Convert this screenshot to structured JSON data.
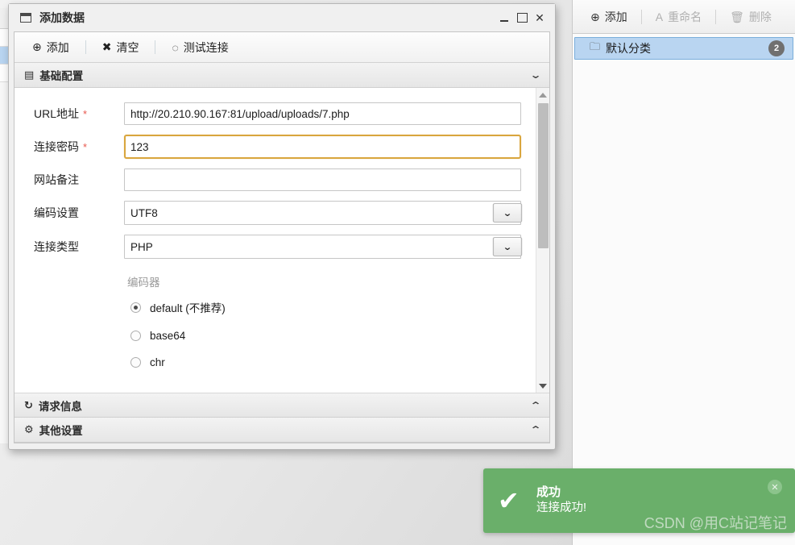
{
  "background_window": {
    "name": "partial-background-window"
  },
  "dialog": {
    "title": "添加数据",
    "title_icon": "window-icon",
    "window_controls": {
      "minimize": "－",
      "maximize": "□",
      "close": "✕"
    },
    "toolbar": [
      {
        "icon": "plus-circle-icon",
        "glyph": "⊕",
        "label": "添加"
      },
      {
        "icon": "cross-icon",
        "glyph": "✖",
        "label": "清空"
      },
      {
        "icon": "spinner-icon",
        "glyph": "◌",
        "label": "测试连接"
      }
    ],
    "sections": {
      "basic": {
        "icon": "document-icon",
        "glyph": "▤",
        "title": "基础配置",
        "chevron": "⌄",
        "expanded": true
      },
      "request": {
        "icon": "refresh-icon",
        "glyph": "↻",
        "title": "请求信息",
        "chevron": "⌃",
        "expanded": false
      },
      "other": {
        "icon": "gears-icon",
        "glyph": "⚙",
        "title": "其他设置",
        "chevron": "⌃",
        "expanded": false
      }
    },
    "form": {
      "fields": [
        {
          "label": "URL地址",
          "required": true,
          "required_mark": "*",
          "type": "text",
          "value": "http://20.210.90.167:81/upload/uploads/7.php",
          "placeholder": "",
          "focused": false
        },
        {
          "label": "连接密码",
          "required": true,
          "required_mark": "*",
          "type": "text",
          "value": "123",
          "placeholder": "",
          "focused": true
        },
        {
          "label": "网站备注",
          "required": false,
          "required_mark": "",
          "type": "text",
          "value": "",
          "placeholder": "",
          "focused": false
        },
        {
          "label": "编码设置",
          "required": false,
          "required_mark": "",
          "type": "select",
          "value": "UTF8",
          "placeholder": "",
          "focused": false
        },
        {
          "label": "连接类型",
          "required": false,
          "required_mark": "",
          "type": "select",
          "value": "PHP",
          "placeholder": "",
          "focused": false
        }
      ],
      "encoder_group": {
        "title": "编码器",
        "options": [
          {
            "label": "default (不推荐)",
            "checked": true
          },
          {
            "label": "base64",
            "checked": false
          },
          {
            "label": "chr",
            "checked": false
          }
        ]
      }
    },
    "scrollbar": {
      "up_arrow": "▲",
      "down_arrow": "▼"
    }
  },
  "right_panel": {
    "toolbar": [
      {
        "icon": "plus-circle-icon",
        "glyph": "⊕",
        "label": "添加",
        "disabled": false
      },
      {
        "icon": "rename-icon",
        "glyph": "A",
        "label": "重命名",
        "disabled": true
      },
      {
        "icon": "trash-icon",
        "glyph": "🗑",
        "label": "删除",
        "disabled": true
      }
    ],
    "tree": [
      {
        "icon": "folder-icon",
        "glyph": "🗀",
        "label": "默认分类",
        "count": "2",
        "selected": true
      }
    ]
  },
  "toast": {
    "check_glyph": "✔",
    "title": "成功",
    "message": "连接成功!",
    "close_glyph": "✕",
    "watermark": "CSDN @用C站记笔记",
    "color": "#6aaf6a"
  }
}
